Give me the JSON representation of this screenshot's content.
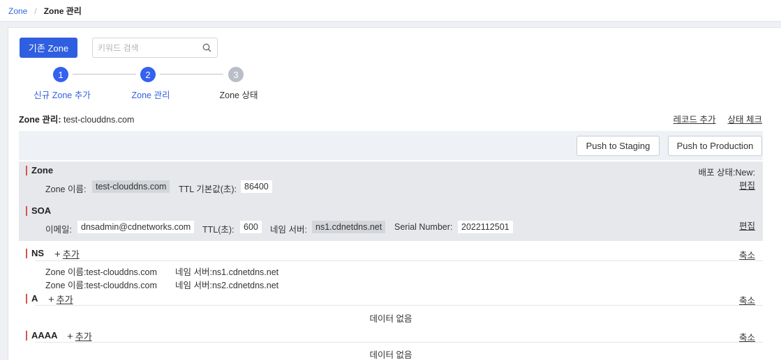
{
  "breadcrumb": {
    "root": "Zone",
    "sep": "/",
    "current": "Zone 관리"
  },
  "toolbar": {
    "existing_zone": "기존 Zone",
    "search_placeholder": "키워드 검색"
  },
  "steps": [
    {
      "num": "1",
      "label": "신규 Zone 추가",
      "state": "done"
    },
    {
      "num": "2",
      "label": "Zone 관리",
      "state": "active"
    },
    {
      "num": "3",
      "label": "Zone 상태",
      "state": "pending"
    }
  ],
  "colors": {
    "primary": "#2f5fe0",
    "step_active": "#3461f0",
    "step_pending": "#b9bec8",
    "accent_bar": "#d9534f"
  },
  "zone_header": {
    "label": "Zone 관리:",
    "name": "test-clouddns.com",
    "add_record": "레코드 추가",
    "status_check": "상태 체크"
  },
  "push": {
    "staging": "Push to Staging",
    "production": "Push to Production"
  },
  "zone": {
    "title": "Zone",
    "deploy_status": "배포 상태:New:",
    "name_label": "Zone 이름:",
    "name_value": "test-clouddns.com",
    "ttl_label": "TTL 기본값(초):",
    "ttl_value": "86400",
    "edit": "편집"
  },
  "soa": {
    "title": "SOA",
    "email_label": "이메일:",
    "email_value": "dnsadmin@cdnetworks.com",
    "ttl_label": "TTL(초):",
    "ttl_value": "600",
    "ns_label": "네임 서버:",
    "ns_value": "ns1.cdnetdns.net",
    "serial_label": "Serial Number:",
    "serial_value": "2022112501",
    "edit": "편집"
  },
  "ns": {
    "title": "NS",
    "add": "추가",
    "collapse": "축소",
    "rows": [
      {
        "zone": "Zone 이름:test-clouddns.com",
        "server": "네임 서버:ns1.cdnetdns.net"
      },
      {
        "zone": "Zone 이름:test-clouddns.com",
        "server": "네임 서버:ns2.cdnetdns.net"
      }
    ]
  },
  "a": {
    "title": "A",
    "add": "추가",
    "collapse": "축소",
    "empty": "데이터 없음"
  },
  "aaaa": {
    "title": "AAAA",
    "add": "추가",
    "collapse": "축소",
    "empty": "데이터 없음"
  }
}
